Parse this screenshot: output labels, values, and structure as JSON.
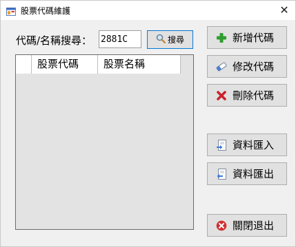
{
  "window": {
    "title": "股票代碼維護",
    "close_glyph": "✕"
  },
  "search": {
    "label": "代碼/名稱搜尋：",
    "value": "2881C",
    "button_label": "搜尋",
    "button_icon": "magnifier-icon"
  },
  "grid": {
    "columns": [
      "股票代碼",
      "股票名稱"
    ],
    "rows": []
  },
  "buttons": {
    "add": {
      "label": "新增代碼",
      "icon": "plus-icon",
      "color": "#2e9e2e"
    },
    "edit": {
      "label": "修改代碼",
      "icon": "eraser-icon",
      "color": "#4d7fd6"
    },
    "delete": {
      "label": "刪除代碼",
      "icon": "x-icon",
      "color": "#c8232c"
    },
    "import": {
      "label": "資料匯入",
      "icon": "import-icon"
    },
    "export": {
      "label": "資料匯出",
      "icon": "export-icon"
    },
    "exit": {
      "label": "關閉退出",
      "icon": "close-circle-icon",
      "color": "#d32f2f"
    }
  }
}
